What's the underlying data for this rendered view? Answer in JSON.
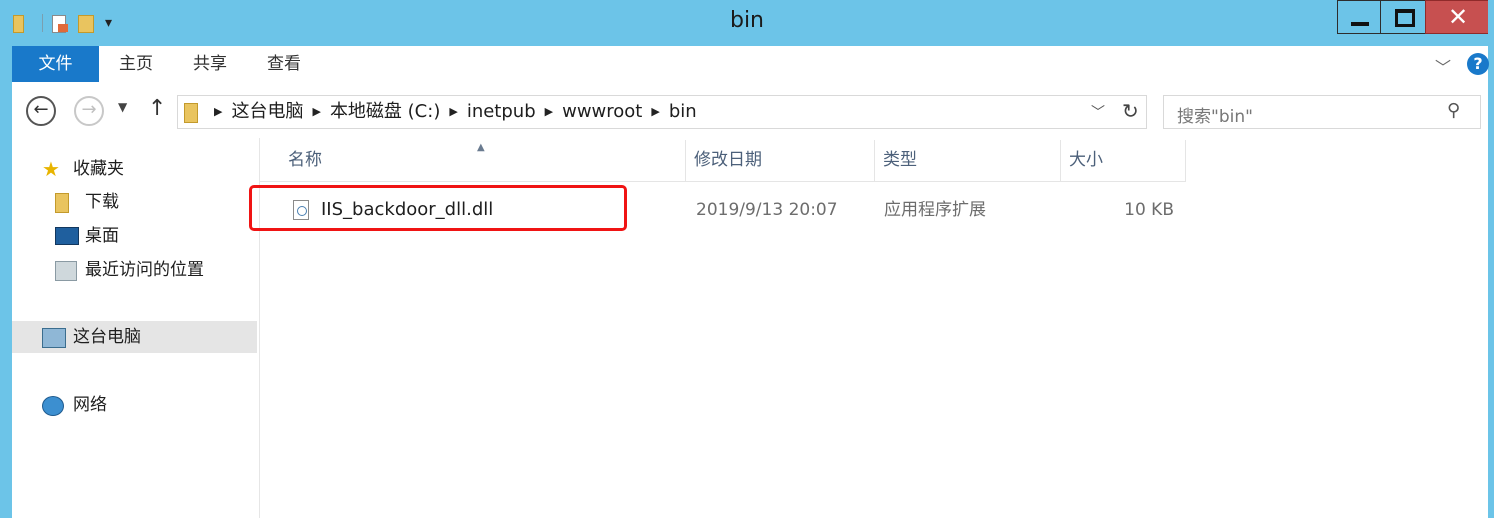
{
  "window": {
    "title": "bin"
  },
  "ribbon": {
    "tabs": [
      "文件",
      "主页",
      "共享",
      "查看"
    ]
  },
  "address": {
    "crumbs": [
      "这台电脑",
      "本地磁盘 (C:)",
      "inetpub",
      "wwwroot",
      "bin"
    ]
  },
  "search": {
    "placeholder": "搜索\"bin\""
  },
  "sidebar": {
    "favorites_label": "收藏夹",
    "items": [
      {
        "label": "下载",
        "icon": "folder-icon"
      },
      {
        "label": "桌面",
        "icon": "desktop-icon"
      },
      {
        "label": "最近访问的位置",
        "icon": "recent-places-icon"
      }
    ],
    "this_pc": "这台电脑",
    "network": "网络"
  },
  "file_list": {
    "columns": [
      "名称",
      "修改日期",
      "类型",
      "大小"
    ],
    "rows": [
      {
        "name": "IIS_backdoor_dll.dll",
        "modified": "2019/9/13 20:07",
        "type": "应用程序扩展",
        "size": "10 KB"
      }
    ]
  },
  "colors": {
    "title_bar": "#6cc4e8",
    "file_tab": "#1979ca",
    "highlight_box": "#f01414"
  }
}
